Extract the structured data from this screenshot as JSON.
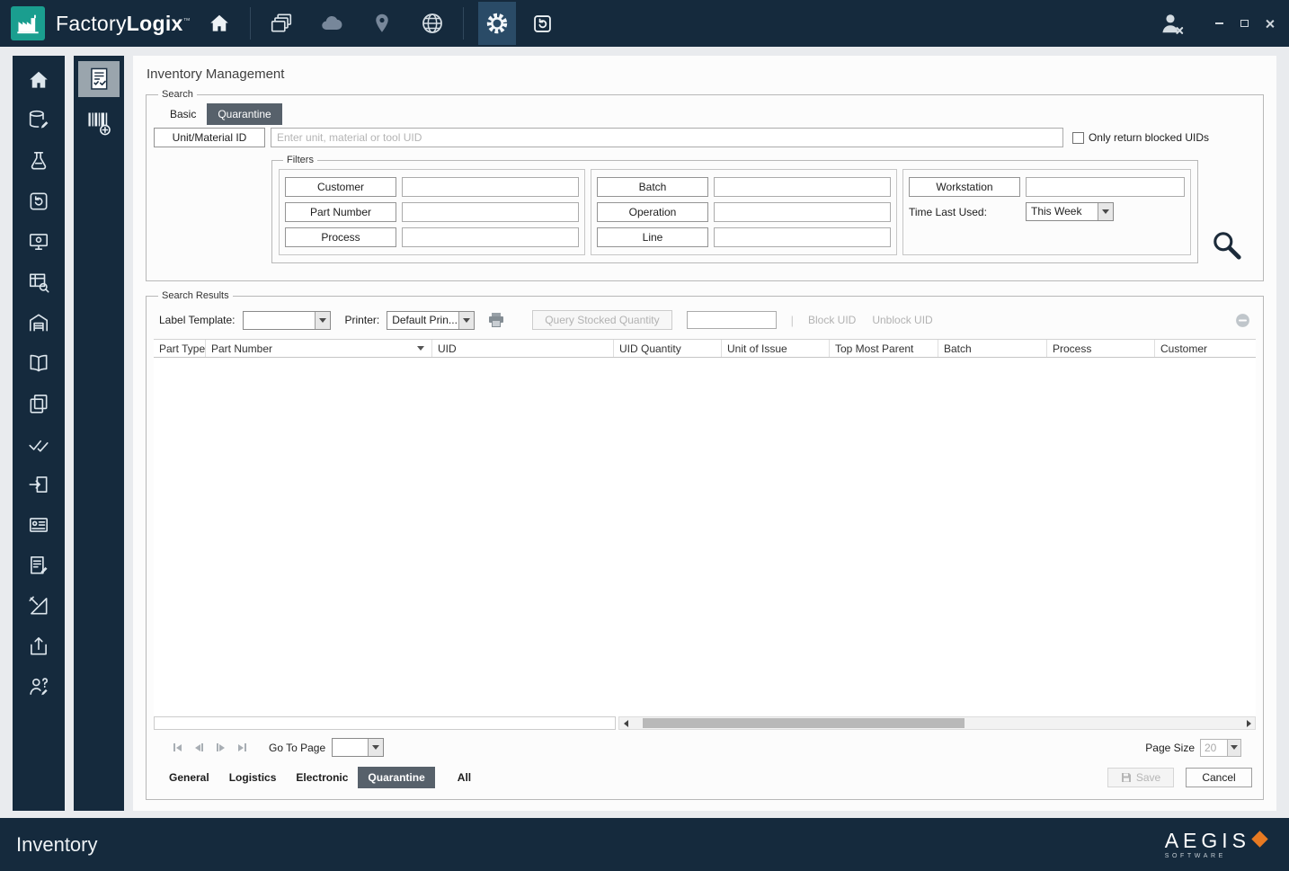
{
  "colors": {
    "chrome": "#152a3d",
    "teal": "#1a9e8f",
    "tab_active": "#57616b",
    "orange": "#e87a22"
  },
  "titlebar": {
    "brand_first": "Factory",
    "brand_second": "Logix",
    "trademark": "™"
  },
  "page": {
    "title": "Inventory Management"
  },
  "search": {
    "label": "Search",
    "tab_basic": "Basic",
    "tab_quarantine": "Quarantine",
    "active_tab": "Quarantine",
    "unit_material_button": "Unit/Material ID",
    "uid_placeholder": "Enter unit, material or tool UID",
    "only_blocked_label": "Only return blocked UIDs",
    "filters": {
      "label": "Filters",
      "customer": "Customer",
      "part_number": "Part Number",
      "process": "Process",
      "batch": "Batch",
      "operation": "Operation",
      "line": "Line",
      "workstation": "Workstation",
      "time_last_used_label": "Time Last Used:",
      "time_last_used_value": "This Week"
    }
  },
  "results": {
    "label": "Search Results",
    "label_template_label": "Label Template:",
    "label_template_value": "",
    "printer_label": "Printer:",
    "printer_value": "Default Prin...",
    "query_stocked_button": "Query Stocked Quantity",
    "block_uid": "Block UID",
    "unblock_uid": "Unblock UID",
    "columns": [
      "Part Type",
      "Part Number",
      "UID",
      "UID Quantity",
      "Unit of Issue",
      "Top Most Parent",
      "Batch",
      "Process",
      "Customer"
    ],
    "rows": [],
    "go_to_page_label": "Go To Page",
    "go_to_page_value": "",
    "page_size_label": "Page Size",
    "page_size_value": "20",
    "tabs": [
      "General",
      "Logistics",
      "Electronic",
      "Quarantine",
      "All"
    ],
    "active_tab": "Quarantine",
    "save_button": "Save",
    "cancel_button": "Cancel"
  },
  "statusbar": {
    "module": "Inventory",
    "brand": "AEGIS",
    "brand_sub": "SOFTWARE"
  }
}
